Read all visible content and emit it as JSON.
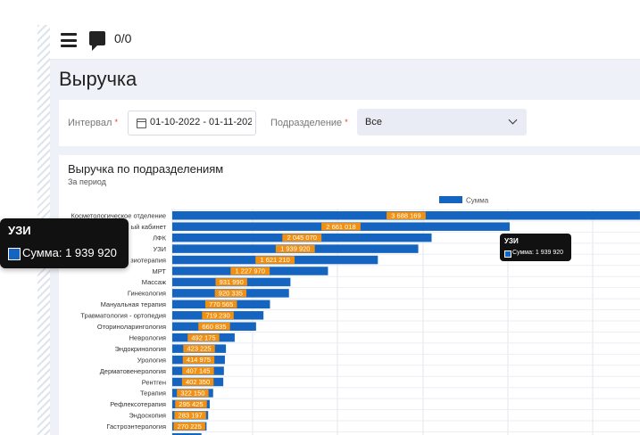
{
  "header": {
    "counter": "0/0"
  },
  "page": {
    "title": "Выручка"
  },
  "filters": {
    "interval_label": "Интервал",
    "interval_value": "01-10-2022 - 01-11-2022",
    "department_label": "Подразделение",
    "department_value": "Все",
    "required_mark": "*"
  },
  "card": {
    "title": "Выручка по подразделениям",
    "subtitle": "За период"
  },
  "tooltip": {
    "title": "УЗИ",
    "text": "Сумма: 1 939 920"
  },
  "colors": {
    "bar": "#1565c0",
    "label_bg": "#f29111"
  },
  "chart_data": {
    "type": "bar",
    "orientation": "horizontal",
    "legend": "top-center",
    "grid": true,
    "series": [
      {
        "name": "Сумма"
      }
    ],
    "xlim": [
      0,
      4000000
    ],
    "categories": [
      "Косметологическое отделение",
      "Стоматологический кабинет",
      "ЛФК",
      "УЗИ",
      "Физиотерапия",
      "МРТ",
      "Массаж",
      "Гинекология",
      "Мануальная терапия",
      "Травматология - ортопедия",
      "Оториноларингология",
      "Неврология",
      "Эндокринология",
      "Урология",
      "Дерматовенерология",
      "Рентген",
      "Терапия",
      "Рефлексотерапия",
      "Эндоскопия",
      "Гастроэнтерология",
      "Педиатрия"
    ],
    "category_labels_shown": [
      "Косметологическое отделение",
      "ый кабинет",
      "ЛФК",
      "УЗИ",
      "зиотерапия",
      "МРТ",
      "Массаж",
      "Гинекология",
      "Мануальная терапия",
      "Травматология - ортопедия",
      "Оториноларингология",
      "Неврология",
      "Эндокринология",
      "Урология",
      "Дерматовенерология",
      "Рентген",
      "Терапия",
      "Рефлексотерапия",
      "Эндоскопия",
      "Гастроэнтерология",
      "Пе"
    ],
    "values": [
      3688169,
      2661018,
      2045070,
      1939920,
      1621210,
      1227970,
      931990,
      920335,
      770565,
      719230,
      660835,
      492175,
      423225,
      414975,
      407145,
      402350,
      322150,
      295425,
      283197,
      270225,
      230000
    ],
    "data_labels": [
      "3 688 169",
      "2 661 018",
      "2 045 070",
      "1 939 920",
      "1 621 210",
      "1 227 970",
      "931 990",
      "920 335",
      "770 565",
      "719 230",
      "660 835",
      "492 175",
      "423 225",
      "414 975",
      "407 145",
      "402 350",
      "322 150",
      "295 425",
      "283 197",
      "270 225",
      ""
    ]
  }
}
